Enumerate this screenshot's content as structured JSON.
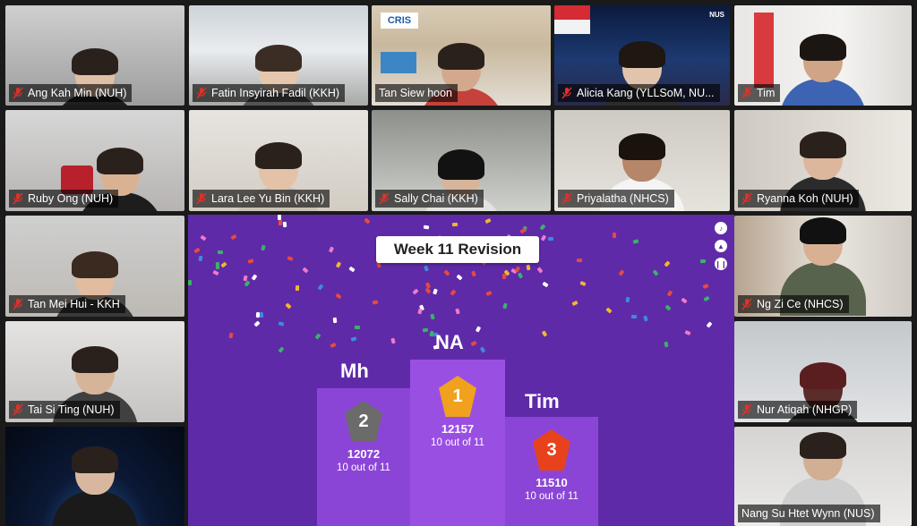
{
  "participants": {
    "ang": "Ang Kah Min (NUH)",
    "fatin": "Fatin Insyirah Fadil (KKH)",
    "tan_siew": "Tan Siew hoon",
    "alicia": "Alicia Kang (YLLSoM, NU...",
    "tim": "Tim",
    "ruby": "Ruby Ong (NUH)",
    "lara": "Lara Lee Yu Bin (KKH)",
    "sally": "Sally Chai (KKH)",
    "priya": "Priyalatha (NHCS)",
    "ryanna": "Ryanna Koh (NUH)",
    "tan_mei": "Tan Mei Hui - KKH",
    "ngzice": "Ng Zi Ce (NHCS)",
    "taisi": "Tai Si Ting (NUH)",
    "nur_atiqah": "Nur Atiqah (NHGP)",
    "nang": "Nang Su Htet Wynn (NUS)"
  },
  "backgrounds": {
    "cris_logo": "CRIS",
    "nus_logo": "NUS"
  },
  "quiz": {
    "title": "Week 11 Revision",
    "first": {
      "name": "NA",
      "rank": "1",
      "score": "12157",
      "correct": "10 out of 11",
      "color": "#f0a11e"
    },
    "second": {
      "name": "Mh",
      "rank": "2",
      "score": "12072",
      "correct": "10 out of 11",
      "color": "#6b6b6b"
    },
    "third": {
      "name": "Tim",
      "rank": "3",
      "score": "11510",
      "correct": "10 out of 11",
      "color": "#e8421c"
    }
  },
  "icons": {
    "muted_mic": "muted-mic-icon",
    "sound": "sound-icon",
    "volume": "volume-icon",
    "pause": "pause-icon"
  },
  "colors": {
    "share_bg": "#5f2aa8",
    "active_speaker": "#e6e05a",
    "muted_red": "#e0302a"
  }
}
